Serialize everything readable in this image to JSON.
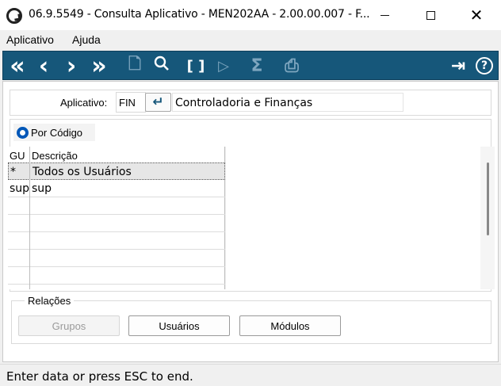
{
  "window": {
    "title": "06.9.5549 - Consulta Aplicativo - MEN202AA - 2.00.00.007 - F...",
    "minimize_glyph": "",
    "close_glyph": "✕"
  },
  "menu": [
    "Aplicativo",
    "Ajuda"
  ],
  "toolbar": {
    "icons": [
      {
        "name": "first-record-icon",
        "glyph": "«"
      },
      {
        "name": "previous-record-icon",
        "glyph": "‹"
      },
      {
        "name": "next-record-icon",
        "glyph": "›"
      },
      {
        "name": "last-record-icon",
        "glyph": "»"
      },
      {
        "name": "new-document-icon",
        "glyph": "🗋"
      },
      {
        "name": "search-icon",
        "glyph": "⚲"
      },
      {
        "name": "brackets-icon",
        "glyph": "[ ]"
      },
      {
        "name": "edit-document-icon",
        "glyph": "▷"
      },
      {
        "name": "sum-icon",
        "glyph": "Σ"
      },
      {
        "name": "print-icon",
        "glyph": "⎙"
      },
      {
        "name": "exit-icon",
        "glyph": "⇥"
      },
      {
        "name": "help-icon",
        "glyph": "?"
      }
    ]
  },
  "form": {
    "app_label": "Aplicativo:",
    "app_code": "FIN",
    "enter_glyph": "↵",
    "app_description": "Controladoria e Finanças"
  },
  "order": {
    "option_label": "Por Código"
  },
  "grid": {
    "columns": [
      "GU",
      "Descrição"
    ],
    "rows": [
      {
        "gu": "*",
        "descricao": "Todos os Usuários"
      },
      {
        "gu": "sup",
        "descricao": "sup"
      }
    ]
  },
  "relations": {
    "title": "Relações",
    "buttons": [
      {
        "label": "Grupos",
        "enabled": false
      },
      {
        "label": "Usuários",
        "enabled": true
      },
      {
        "label": "Módulos",
        "enabled": true
      }
    ]
  },
  "status": {
    "text": "Enter data or press ESC to end."
  }
}
